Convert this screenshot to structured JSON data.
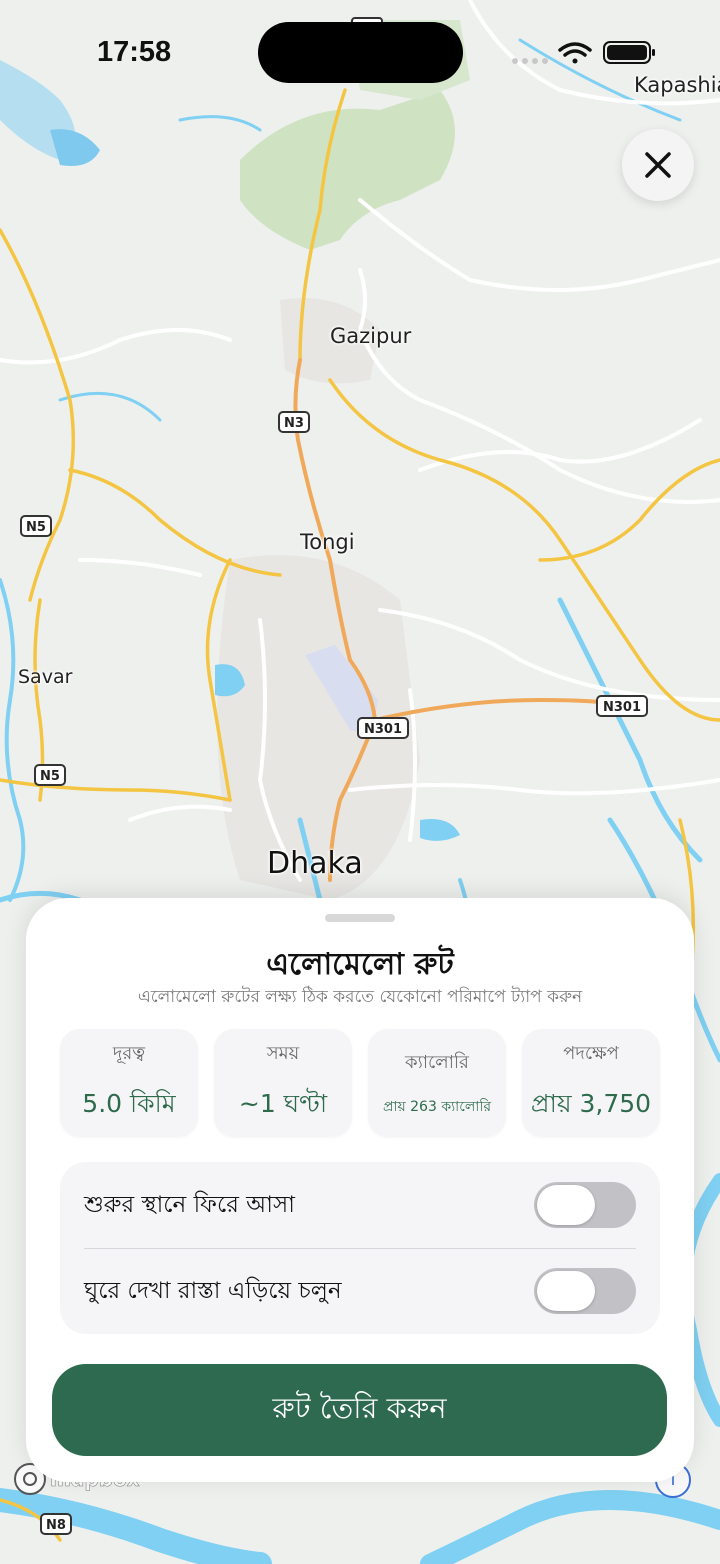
{
  "status_bar": {
    "time": "17:58"
  },
  "map": {
    "places": [
      {
        "key": "kapashia",
        "label": "Kapashia"
      },
      {
        "key": "gazipur",
        "label": "Gazipur"
      },
      {
        "key": "tongi",
        "label": "Tongi"
      },
      {
        "key": "savar",
        "label": "Savar"
      },
      {
        "key": "dhaka",
        "label": "Dhaka"
      }
    ],
    "road_shields": [
      "N3",
      "N5",
      "N5",
      "N301",
      "N301",
      "N8"
    ],
    "attribution": "mapbox",
    "info_label": "i"
  },
  "sheet": {
    "title": "এলোমেলো রুট",
    "subtitle": "এলোমেলো রুটের লক্ষ্য ঠিক করতে যেকোনো পরিমাপে ট্যাপ করুন",
    "stats": [
      {
        "label": "দূরত্ব",
        "value": "5.0 কিমি"
      },
      {
        "label": "সময়",
        "value": "~1 ঘণ্টা"
      },
      {
        "label": "ক্যালোরি",
        "value": "প্রায় 263 ক্যালোরি"
      },
      {
        "label": "পদক্ষেপ",
        "value": "প্রায় 3,750"
      }
    ],
    "options": [
      {
        "label": "শুরুর স্থানে ফিরে আসা",
        "enabled": false
      },
      {
        "label": "ঘুরে দেখা রাস্তা এড়িয়ে চলুন",
        "enabled": false
      }
    ],
    "create_button": "রুট তৈরি করুন"
  },
  "colors": {
    "accent": "#2d6a4f",
    "stat_value": "#2e6a4c",
    "water": "#7fd0f2",
    "primary_road": "#f4c542",
    "trunk_road": "#f0a95a",
    "toggle_off": "#c2c2c6"
  }
}
